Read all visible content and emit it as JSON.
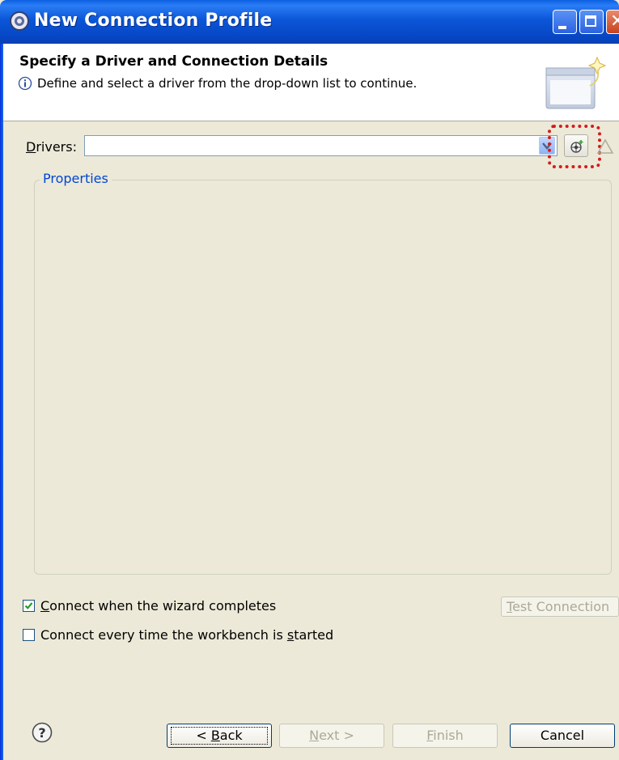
{
  "window": {
    "title": "New Connection Profile",
    "minimize_label": "minimize",
    "maximize_label": "maximize",
    "close_label": "close"
  },
  "banner": {
    "title": "Specify a Driver and Connection Details",
    "message": "Define and select a driver from the drop-down list to continue."
  },
  "drivers": {
    "label_mnemonic": "D",
    "label_rest": "rivers:",
    "value": ""
  },
  "properties": {
    "group_label": "Properties"
  },
  "options": {
    "connect_on_complete": {
      "label": "Connect when the wizard completes",
      "mnemonic": "C",
      "checked": true
    },
    "connect_every_time": {
      "label_before": "Connect every time the workbench is ",
      "mnemonic": "s",
      "label_after": "tarted",
      "checked": false
    }
  },
  "test_connection": {
    "mnemonic": "T",
    "rest": "est Connection",
    "enabled": false
  },
  "buttons": {
    "back": {
      "prefix": "< ",
      "mnemonic": "B",
      "rest": "ack",
      "enabled": true
    },
    "next": {
      "mnemonic": "N",
      "rest": "ext >",
      "enabled": false
    },
    "finish": {
      "mnemonic": "F",
      "rest": "inish",
      "enabled": false
    },
    "cancel": {
      "label": "Cancel",
      "enabled": true
    }
  },
  "icons": {
    "title": "eclipse-gear-icon",
    "info": "info-icon",
    "banner": "wizard-banner-icon",
    "new_driver": "new-driver-icon",
    "edit_driver": "edit-driver-icon",
    "help": "help-icon"
  },
  "colors": {
    "title_bar": "#0a56d8",
    "highlight": "#d41c1c",
    "group_label": "#0046d5",
    "disabled_text": "#aca899"
  }
}
